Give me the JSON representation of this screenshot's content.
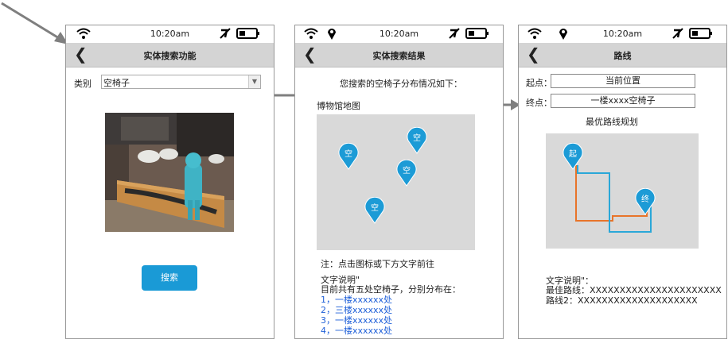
{
  "status": {
    "time": "10:20am"
  },
  "screen1": {
    "title": "实体搜索功能",
    "category_label": "类别",
    "category_value": "空椅子",
    "search_button": "搜索"
  },
  "screen2": {
    "title": "实体搜索结果",
    "heading": "您搜索的空椅子分布情况如下：",
    "map_label": "博物馆地图",
    "pin_label": "空",
    "note": "注：点击图标或下方文字前往",
    "desc_title": "文字说明\"",
    "desc_summary": "目前共有五处空椅子，分别分布在：",
    "locations": [
      "1，一楼xxxxxx处",
      "2，三楼xxxxxx处",
      "3，一楼xxxxxx处",
      "4，一楼xxxxxx处"
    ]
  },
  "screen3": {
    "title": "路线",
    "start_label": "起点：",
    "start_value": "当前位置",
    "end_label": "终点：",
    "end_value": "一楼xxxx空椅子",
    "plan_label": "最优路线规划",
    "start_pin": "起",
    "end_pin": "终",
    "desc_title": "文字说明\"：",
    "route1": "最佳路线：XXXXXXXXXXXXXXXXXXXXXX",
    "route2": "路线2：XXXXXXXXXXXXXXXXXXXX"
  },
  "colors": {
    "route_orange": "#e8742a",
    "route_blue": "#2aa7d8",
    "pin_blue": "#1c9bd6",
    "button_blue": "#1a9ad6"
  }
}
